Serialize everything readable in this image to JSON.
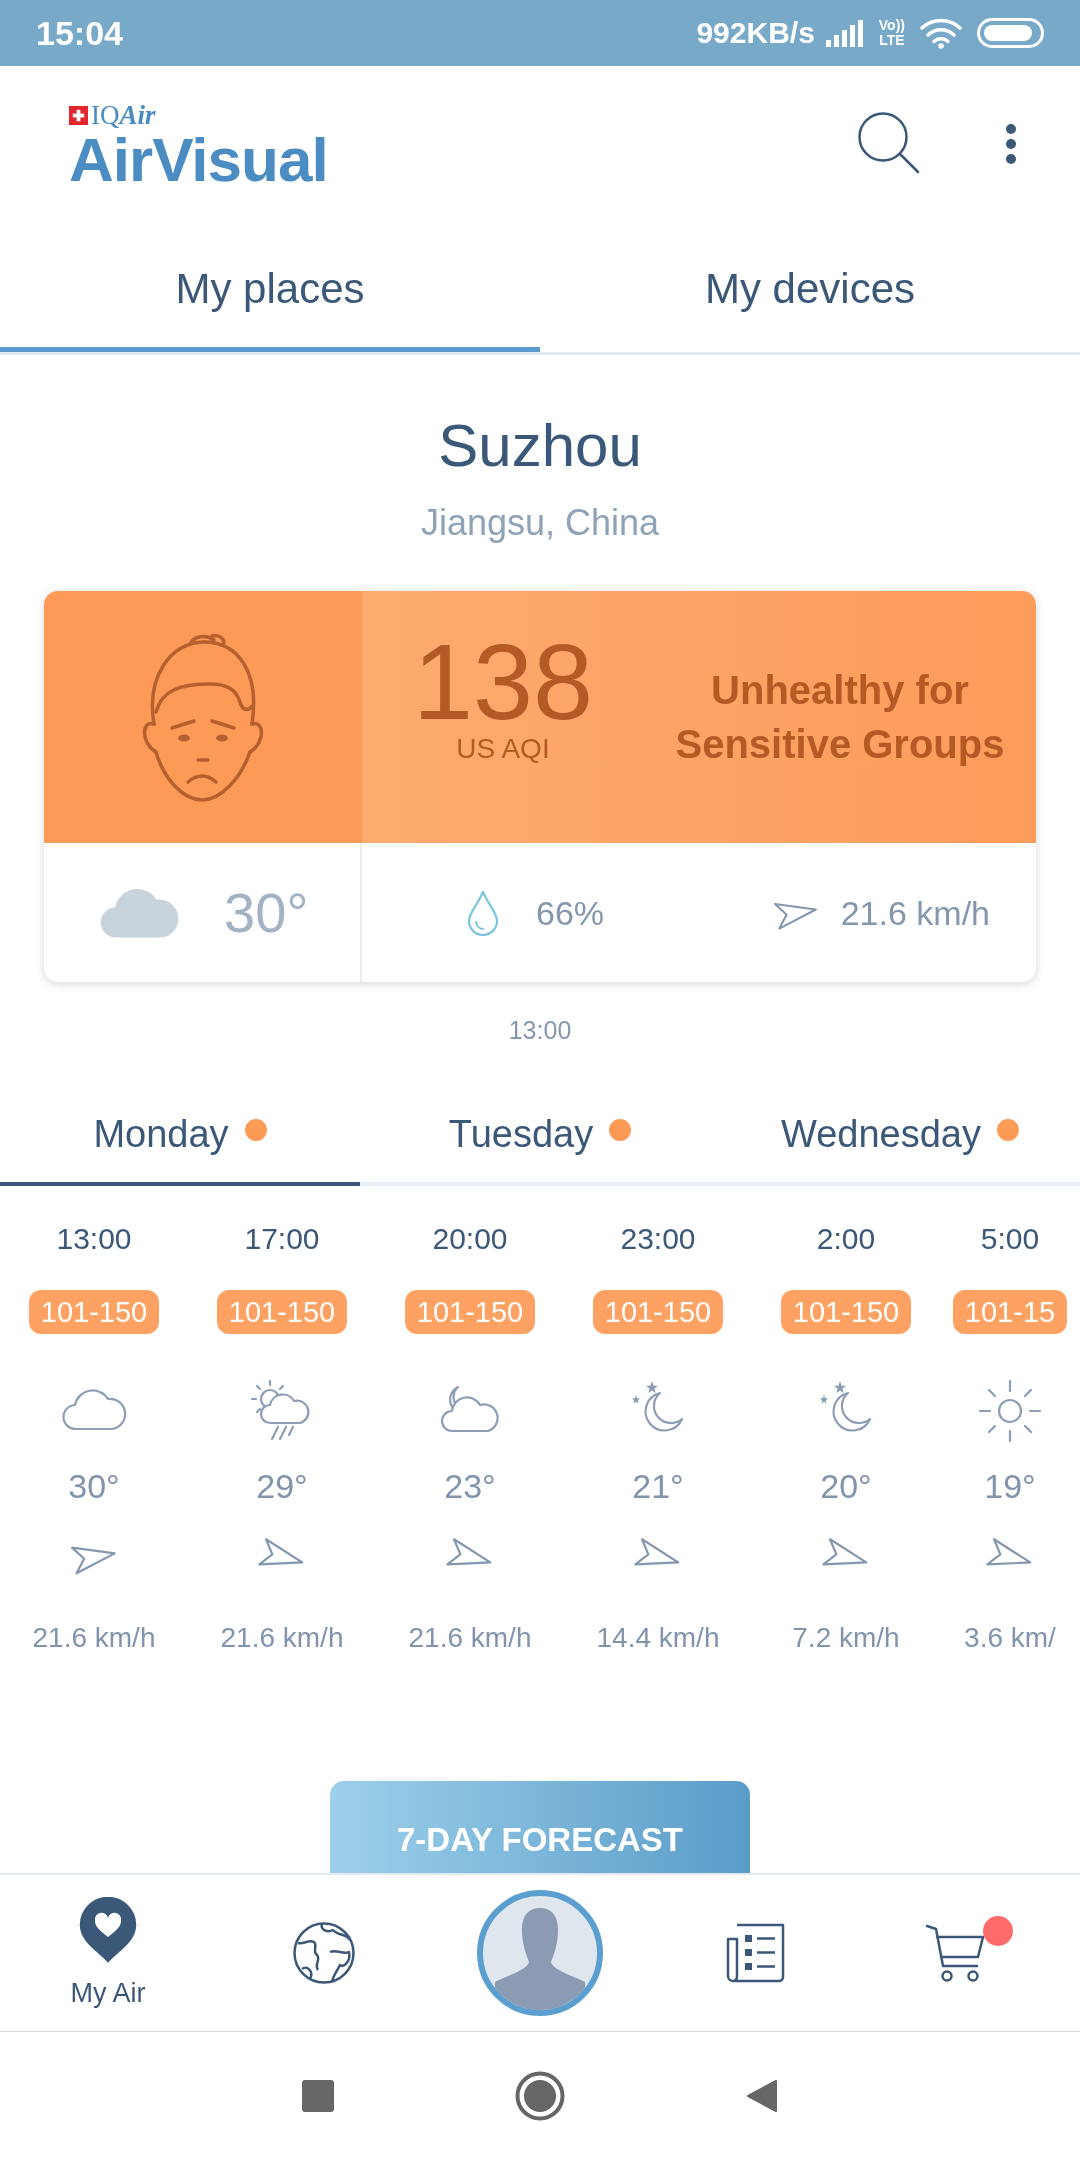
{
  "status_bar": {
    "time": "15:04",
    "network_speed": "992KB/s",
    "volte": "Vo))",
    "lte": "LTE"
  },
  "header": {
    "brand": {
      "prefix": "IQ",
      "suffix": "Air"
    },
    "app_name": "AirVisual"
  },
  "tabs": [
    {
      "label": "My places",
      "selected": true
    },
    {
      "label": "My devices",
      "selected": false
    }
  ],
  "location": {
    "city": "Suzhou",
    "region": "Jiangsu, China"
  },
  "aqi_card": {
    "aqi": "138",
    "unit": "US AQI",
    "category": "Unhealthy for Sensitive Groups",
    "weather": {
      "kind": "cloudy",
      "temperature": "30°"
    },
    "humidity": "66%",
    "wind": {
      "kind": "east",
      "speed": "21.6 km/h"
    }
  },
  "updated_at": "13:00",
  "day_tabs": [
    {
      "label": "Monday",
      "selected": true
    },
    {
      "label": "Tuesday",
      "selected": false
    },
    {
      "label": "Wednesday",
      "selected": false
    }
  ],
  "hourly": [
    {
      "time": "13:00",
      "aqi_range": "101-150",
      "kind": "cloudy",
      "temperature": "30°",
      "wind": {
        "kind": "east",
        "speed": "21.6 km/h"
      }
    },
    {
      "time": "17:00",
      "aqi_range": "101-150",
      "kind": "showers",
      "temperature": "29°",
      "wind": {
        "kind": "southeast",
        "speed": "21.6 km/h"
      }
    },
    {
      "time": "20:00",
      "aqi_range": "101-150",
      "kind": "cloudy-night",
      "temperature": "23°",
      "wind": {
        "kind": "southeast",
        "speed": "21.6 km/h"
      }
    },
    {
      "time": "23:00",
      "aqi_range": "101-150",
      "kind": "clear-night",
      "temperature": "21°",
      "wind": {
        "kind": "southeast",
        "speed": "14.4 km/h"
      }
    },
    {
      "time": "2:00",
      "aqi_range": "101-150",
      "kind": "clear-night",
      "temperature": "20°",
      "wind": {
        "kind": "southeast",
        "speed": "7.2 km/h"
      }
    },
    {
      "time": "5:00",
      "aqi_range": "101-15",
      "kind": "sunny",
      "temperature": "19°",
      "wind": {
        "kind": "southeast",
        "speed": "3.6 km/"
      }
    }
  ],
  "forecast_button": "7-DAY FORECAST",
  "bottom_nav": [
    {
      "kind": "my-air",
      "label": "My Air",
      "selected": true,
      "notification": false
    },
    {
      "kind": "globe",
      "selected": false,
      "notification": false
    },
    {
      "kind": "profile",
      "selected": false,
      "notification": false
    },
    {
      "kind": "news",
      "selected": false,
      "notification": false
    },
    {
      "kind": "cart",
      "selected": false,
      "notification": true
    }
  ]
}
